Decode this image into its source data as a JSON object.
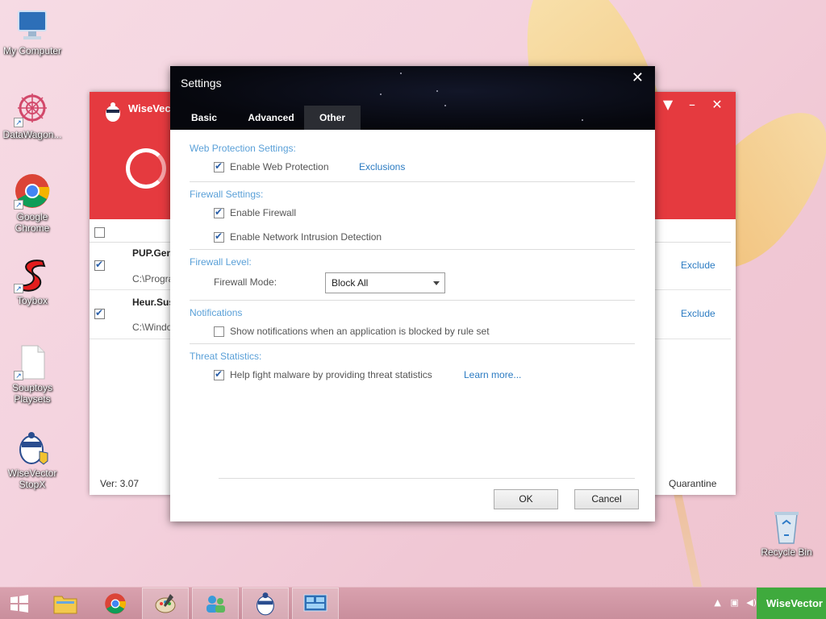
{
  "desktop": {
    "icons": [
      {
        "label": "My Computer"
      },
      {
        "label": "DataWagon..."
      },
      {
        "label": "Google Chrome"
      },
      {
        "label": "Toybox"
      },
      {
        "label": "Souptoys Playsets"
      },
      {
        "label": "WiseVector StopX"
      },
      {
        "label": "Recycle Bin"
      }
    ]
  },
  "app": {
    "title": "WiseVecto",
    "threats": [
      {
        "name": "PUP.Gen",
        "path": "C:\\Progra",
        "action": "Exclude"
      },
      {
        "name": "Heur.Sus",
        "path": "C:\\Windo",
        "action": "Exclude"
      }
    ],
    "version": "Ver: 3.07",
    "quarantine": "Quarantine",
    "accent": "#e53a3f"
  },
  "dialog": {
    "title": "Settings",
    "close": "✕",
    "tabs": [
      "Basic",
      "Advanced",
      "Other"
    ],
    "active_tab": "Other",
    "sections": {
      "web_protection": {
        "title": "Web Protection Settings:",
        "enable_label": "Enable Web Protection",
        "enable_checked": true,
        "exclusions_link": "Exclusions"
      },
      "firewall": {
        "title": "Firewall Settings:",
        "enable_label": "Enable Firewall",
        "enable_checked": true,
        "nids_label": "Enable Network Intrusion Detection",
        "nids_checked": true
      },
      "firewall_level": {
        "title": "Firewall Level:",
        "mode_label": "Firewall Mode:",
        "mode_value": "Block All"
      },
      "notifications": {
        "title": "Notifications",
        "show_label": "Show notifications when an application is blocked by rule set",
        "show_checked": false
      },
      "threat_stats": {
        "title": "Threat Statistics:",
        "help_label": "Help fight malware by providing threat statistics",
        "help_checked": true,
        "learn_more": "Learn more..."
      }
    },
    "ok_label": "OK",
    "cancel_label": "Cancel"
  },
  "taskbar": {
    "notify_text": "WiseVector"
  }
}
